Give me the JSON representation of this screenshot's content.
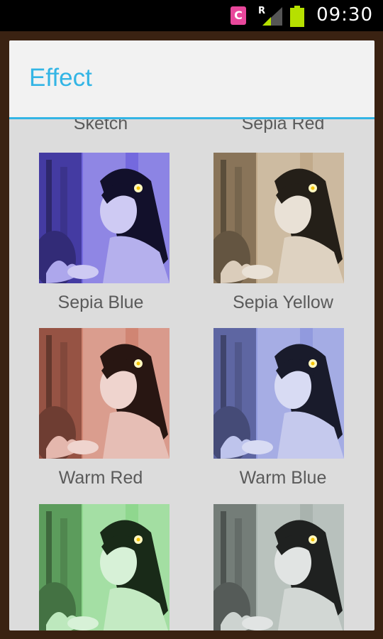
{
  "status_bar": {
    "time": "09:30",
    "notification_icon_letter": "C",
    "icons": [
      "app-notification-icon",
      "signal-icon",
      "battery-icon"
    ]
  },
  "dialog": {
    "title": "Effect",
    "accent_color": "#33b5e5",
    "effects": [
      {
        "label": "Sketch",
        "tint": null
      },
      {
        "label": "Sepia Red",
        "tint": null
      },
      {
        "label": "Sepia Blue",
        "tint": "#5b4fd8"
      },
      {
        "label": "Sepia Yellow",
        "tint": "#b69b76"
      },
      {
        "label": "Warm Red",
        "tint": "#c86f5a"
      },
      {
        "label": "Warm Blue",
        "tint": "#7d88d8"
      },
      {
        "label": "",
        "tint": "#7bd07a"
      },
      {
        "label": "",
        "tint": "#9aa6a0"
      }
    ]
  }
}
